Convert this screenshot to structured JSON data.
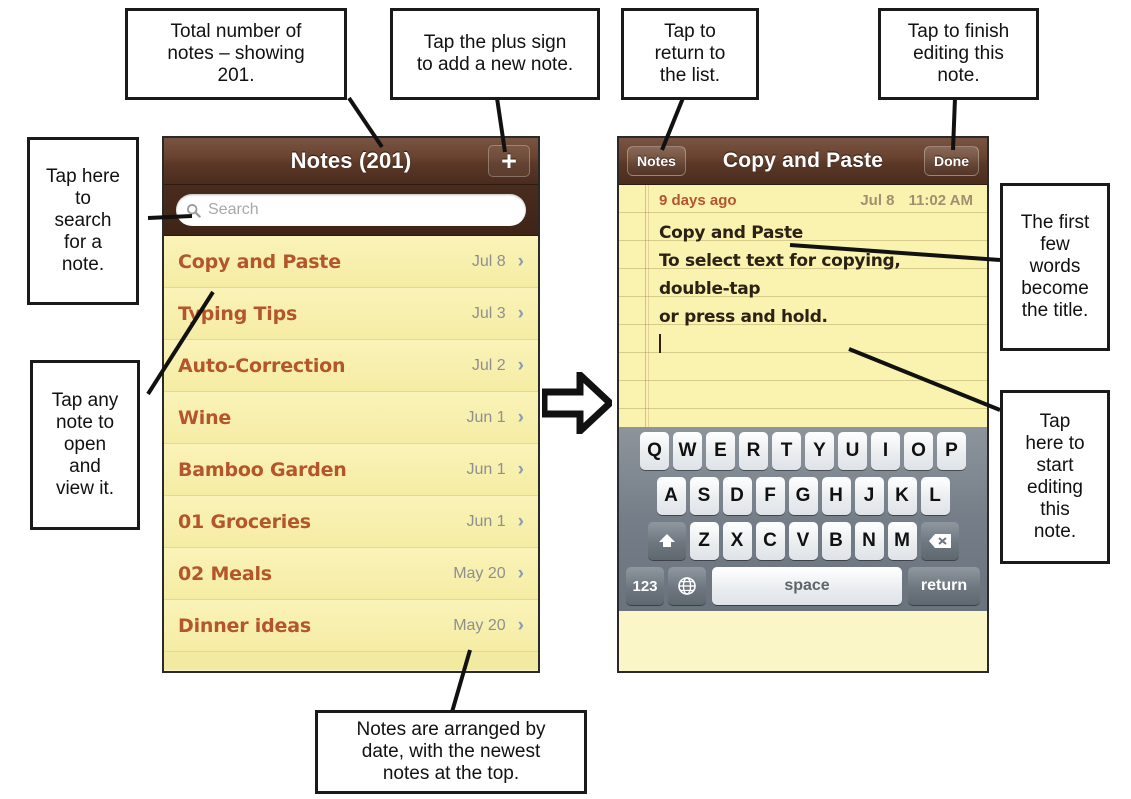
{
  "figure": {
    "description": "Annotated iPhone Notes app screenshots: list view and note editing view"
  },
  "callouts": [
    {
      "id": "total-notes",
      "text": "Total number of\nnotes – showing\n201."
    },
    {
      "id": "add-note",
      "text": "Tap the plus sign\nto add a new note."
    },
    {
      "id": "return-list",
      "text": "Tap to\nreturn to\nthe list."
    },
    {
      "id": "finish-editing",
      "text": "Tap to finish\nediting this\nnote."
    },
    {
      "id": "search-note",
      "text": "Tap here\nto\nsearch\nfor a\nnote."
    },
    {
      "id": "open-note",
      "text": "Tap any\nnote to\nopen\nand\nview it."
    },
    {
      "id": "first-words",
      "text": "The first\nfew\nwords\nbecome\nthe title."
    },
    {
      "id": "start-editing",
      "text": "Tap\nhere to\nstart\nediting\nthis\nnote."
    },
    {
      "id": "sorted-by-date",
      "text": "Notes are arranged by\ndate, with the newest\nnotes at the top."
    }
  ],
  "list_screen": {
    "nav": {
      "title": "Notes (201)",
      "add_button_label": "+",
      "add_button_icon": "plus-icon"
    },
    "search": {
      "placeholder": "Search",
      "value": "",
      "icon": "search-icon"
    },
    "notes": [
      {
        "title": "Copy and Paste",
        "date": "Jul 8",
        "chevron": "›"
      },
      {
        "title": "Typing Tips",
        "date": "Jul 3",
        "chevron": "›"
      },
      {
        "title": "Auto-Correction",
        "date": "Jul 2",
        "chevron": "›"
      },
      {
        "title": "Wine",
        "date": "Jun 1",
        "chevron": "›"
      },
      {
        "title": "Bamboo Garden",
        "date": "Jun 1",
        "chevron": "›"
      },
      {
        "title": "01 Groceries",
        "date": "Jun 1",
        "chevron": "›"
      },
      {
        "title": "02 Meals",
        "date": "May 20",
        "chevron": "›"
      },
      {
        "title": "Dinner ideas",
        "date": "May 20",
        "chevron": "›"
      }
    ]
  },
  "detail_screen": {
    "nav": {
      "back_label": "Notes",
      "title": "Copy and Paste",
      "done_label": "Done"
    },
    "meta": {
      "relative": "9 days ago",
      "date": "Jul 8",
      "time": "11:02 AM"
    },
    "body": {
      "line1": "Copy and Paste",
      "line2": "To select text for copying, double-tap",
      "line3": "or press and hold."
    },
    "keyboard": {
      "row1": [
        "Q",
        "W",
        "E",
        "R",
        "T",
        "Y",
        "U",
        "I",
        "O",
        "P"
      ],
      "row2": [
        "A",
        "S",
        "D",
        "F",
        "G",
        "H",
        "J",
        "K",
        "L"
      ],
      "row3": [
        "Z",
        "X",
        "C",
        "V",
        "B",
        "N",
        "M"
      ],
      "shift_icon": "shift-up-arrow-icon",
      "backspace_icon": "backspace-icon",
      "numbers_label": "123",
      "globe_icon": "globe-icon",
      "space_label": "space",
      "return_label": "return"
    }
  },
  "flow_arrow": {
    "icon": "right-arrow-icon"
  },
  "colors": {
    "nav_brown_top": "#7a5443",
    "nav_brown_bottom": "#4a2c1e",
    "paper_yellow": "#faf3b0",
    "note_title_orange": "#b4552c",
    "date_gray": "#8f8f8f",
    "chevron_blue": "#8c9bb0",
    "keyboard_gray": "#757e88"
  }
}
